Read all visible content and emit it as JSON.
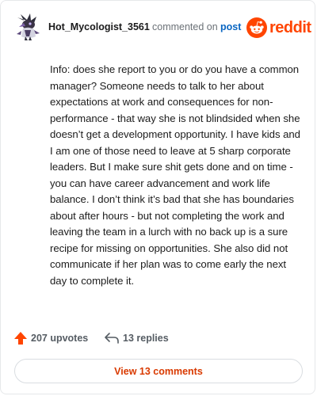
{
  "header": {
    "username": "Hot_Mycologist_3561",
    "action_text": "commented on",
    "post_link": "post",
    "brand": "reddit",
    "brand_color": "#ff4500",
    "avatar_icon": "snoo-avatar-icon"
  },
  "comment": {
    "body": "Info: does she report to you or do you have a common manager? Someone needs to talk to her about expectations at work and consequences for non-performance - that way she is not blindsided when she doesn’t get a development opportunity. I have kids and I am one of those need to leave at 5 sharp corporate leaders. But I make sure shit gets done and on time - you can have career advancement and work life balance. I don’t think it’s bad that she has boundaries about after hours - but not completing the work and leaving the team in a lurch with no back up is a sure recipe for missing on opportunities. She also did not communicate if her plan was to come early the next day to complete it."
  },
  "stats": {
    "upvotes": "207 upvotes",
    "upvote_icon": "upvote-arrow-icon",
    "upvote_color": "#ff4500",
    "replies": "13 replies",
    "reply_icon": "reply-arrow-icon"
  },
  "footer": {
    "view_comments": "View 13 comments",
    "accent_color": "#d93a00"
  }
}
